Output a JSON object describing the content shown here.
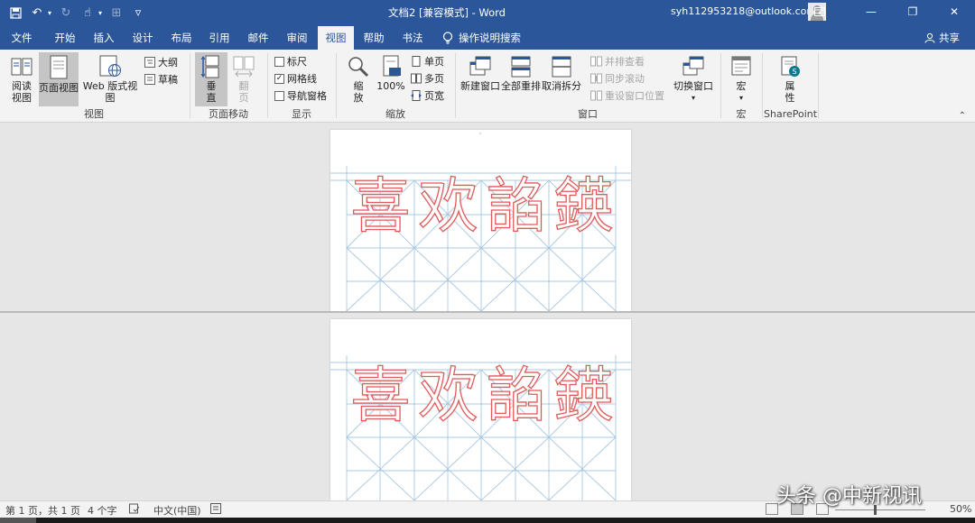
{
  "titlebar": {
    "doc_title": "文档2 [兼容模式] - Word",
    "account": "syh112953218@outlook.com"
  },
  "tabs": [
    "文件",
    "开始",
    "插入",
    "设计",
    "布局",
    "引用",
    "邮件",
    "审阅",
    "视图",
    "帮助",
    "书法"
  ],
  "active_tab": "视图",
  "tell_me": "操作说明搜索",
  "share": "共享",
  "ribbon": {
    "views": {
      "read": "阅读\n视图",
      "print": "页面视图",
      "web": "Web 版式视图",
      "outline": "大纲",
      "draft": "草稿",
      "label": "视图"
    },
    "page_movement": {
      "vertical": "垂\n直",
      "side": "翻\n页",
      "label": "页面移动"
    },
    "show": {
      "ruler": "标尺",
      "gridlines": "网格线",
      "nav_pane": "导航窗格",
      "label": "显示",
      "ruler_checked": false,
      "gridlines_checked": true,
      "nav_checked": false
    },
    "zoom": {
      "zoom": "缩\n放",
      "hundred": "100%",
      "one_page": "单页",
      "multi_page": "多页",
      "page_width": "页宽",
      "label": "缩放"
    },
    "window": {
      "new_window": "新建窗口",
      "arrange_all": "全部重排",
      "split": "取消拆分",
      "side_by_side": "并排查看",
      "sync_scroll": "同步滚动",
      "reset_pos": "重设窗口位置",
      "switch": "切换窗口",
      "label": "窗口"
    },
    "macros": {
      "macros": "宏",
      "label": "宏"
    },
    "sharepoint": {
      "properties": "属\n性",
      "label": "SharePoint"
    }
  },
  "document": {
    "page1_chars": [
      "喜",
      "欢",
      "諂",
      "鍈"
    ],
    "page2_chars": [
      "喜",
      "欢",
      "諂",
      "鍈"
    ]
  },
  "statusbar": {
    "page": "第 1 页，共 1 页",
    "words": "4 个字",
    "lang": "中文(中国)",
    "zoom": "50%"
  },
  "watermark": "头条 @中新视讯",
  "colors": {
    "brand": "#2b579a",
    "grid_line": "#a9c8e0",
    "char_stroke": "#e05a5a"
  }
}
